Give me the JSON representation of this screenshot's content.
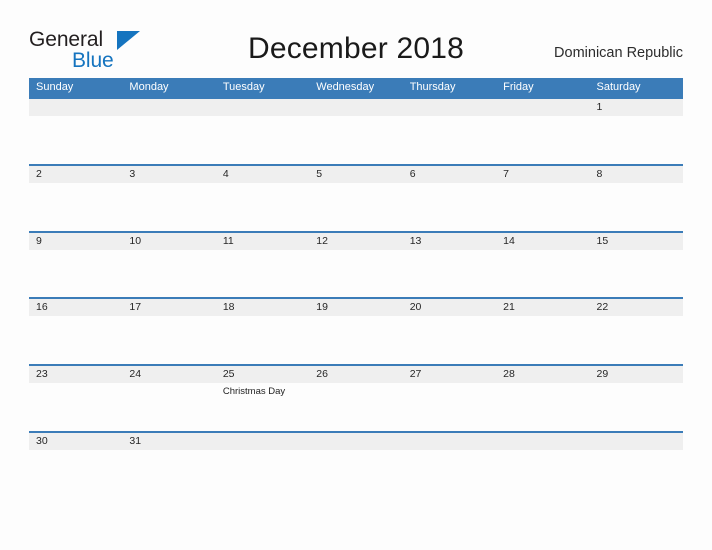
{
  "brand": {
    "name_part1": "General",
    "name_part2": "Blue",
    "sail_icon": "sail-triangle-icon",
    "primary_color": "#1574bf"
  },
  "header": {
    "title": "December 2018",
    "region": "Dominican Republic"
  },
  "calendar": {
    "header_color": "#3b7cb8",
    "band_color": "#efefef",
    "weekdays": [
      "Sunday",
      "Monday",
      "Tuesday",
      "Wednesday",
      "Thursday",
      "Friday",
      "Saturday"
    ],
    "weeks": [
      [
        {
          "day": ""
        },
        {
          "day": ""
        },
        {
          "day": ""
        },
        {
          "day": ""
        },
        {
          "day": ""
        },
        {
          "day": ""
        },
        {
          "day": "1"
        }
      ],
      [
        {
          "day": "2"
        },
        {
          "day": "3"
        },
        {
          "day": "4"
        },
        {
          "day": "5"
        },
        {
          "day": "6"
        },
        {
          "day": "7"
        },
        {
          "day": "8"
        }
      ],
      [
        {
          "day": "9"
        },
        {
          "day": "10"
        },
        {
          "day": "11"
        },
        {
          "day": "12"
        },
        {
          "day": "13"
        },
        {
          "day": "14"
        },
        {
          "day": "15"
        }
      ],
      [
        {
          "day": "16"
        },
        {
          "day": "17"
        },
        {
          "day": "18"
        },
        {
          "day": "19"
        },
        {
          "day": "20"
        },
        {
          "day": "21"
        },
        {
          "day": "22"
        }
      ],
      [
        {
          "day": "23"
        },
        {
          "day": "24"
        },
        {
          "day": "25",
          "event": "Christmas Day"
        },
        {
          "day": "26"
        },
        {
          "day": "27"
        },
        {
          "day": "28"
        },
        {
          "day": "29"
        }
      ],
      [
        {
          "day": "30"
        },
        {
          "day": "31"
        },
        {
          "day": ""
        },
        {
          "day": ""
        },
        {
          "day": ""
        },
        {
          "day": ""
        },
        {
          "day": ""
        }
      ]
    ]
  }
}
